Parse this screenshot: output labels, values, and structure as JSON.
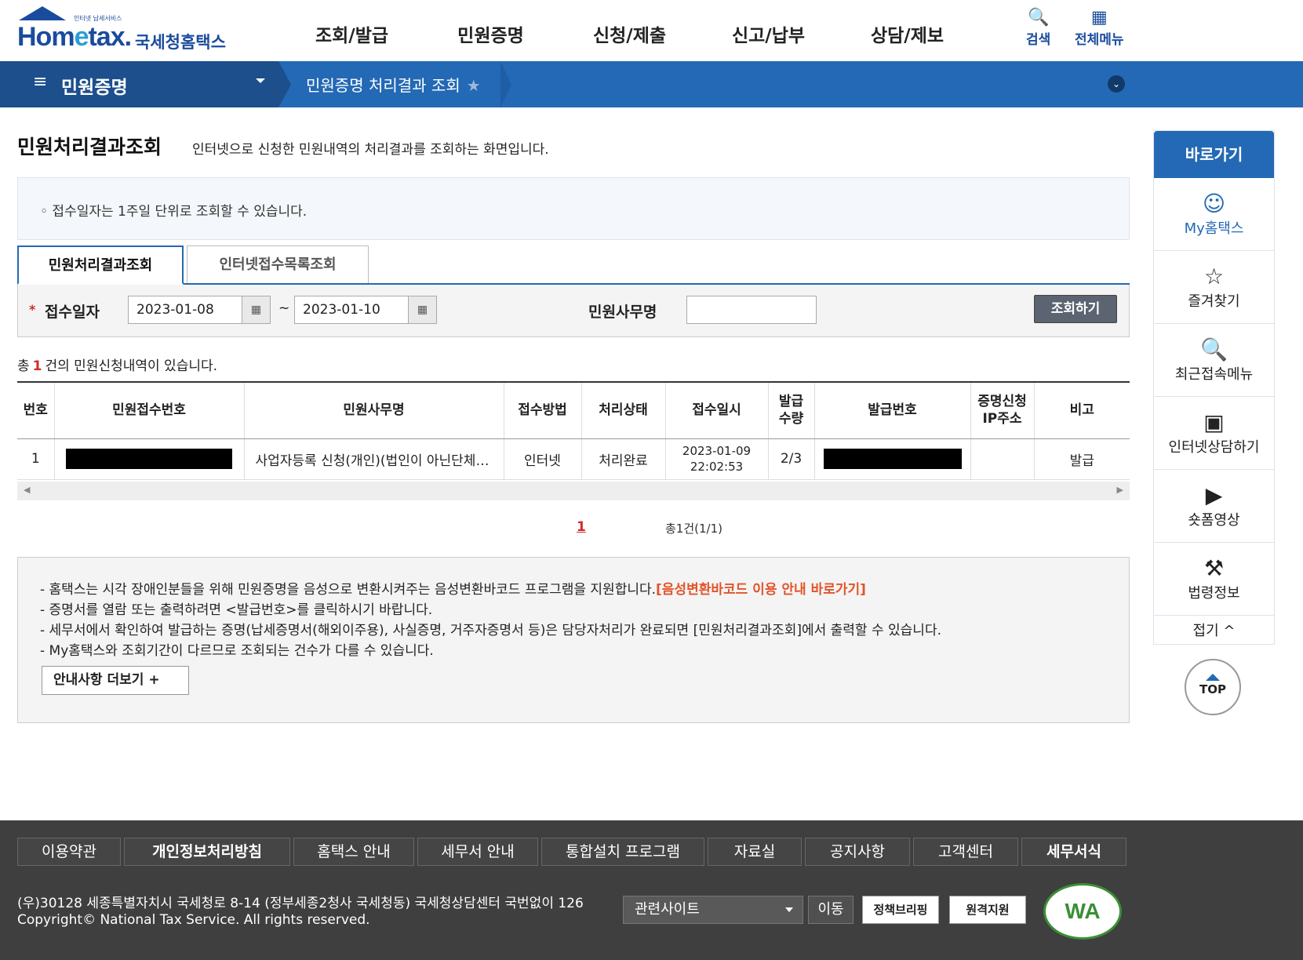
{
  "header": {
    "logo_tiny": "인터넷 납세서비스",
    "logo_main_a": "Hom",
    "logo_main_e": "e",
    "logo_main_b": "tax.",
    "logo_sub": "국세청홈택스",
    "gnb": [
      "조회/발급",
      "민원증명",
      "신청/제출",
      "신고/납부",
      "상담/제보"
    ],
    "search_label": "검색",
    "allmenu_label": "전체메뉴"
  },
  "navbar": {
    "menu_label": "민원증명",
    "breadcrumb": "민원증명 처리결과 조회"
  },
  "page": {
    "title": "민원처리결과조회",
    "description": "인터넷으로 신청한 민원내역의 처리결과를 조회하는 화면입니다.",
    "notice": "◦ 접수일자는 1주일 단위로 조회할 수 있습니다."
  },
  "tabs": [
    "민원처리결과조회",
    "인터넷접수목록조회"
  ],
  "search": {
    "required_mark": "*",
    "date_label": "접수일자",
    "date_from": "2023-01-08",
    "date_to": "2023-01-10",
    "tilde": "~",
    "office_label": "민원사무명",
    "office_value": "",
    "search_button": "조회하기"
  },
  "count": {
    "prefix": "총",
    "num": "1",
    "suffix": "건의 민원신청내역이 있습니다."
  },
  "table": {
    "headers": [
      "번호",
      "민원접수번호",
      "민원사무명",
      "접수방법",
      "처리상태",
      "접수일시",
      "발급\n수량",
      "발급번호",
      "증명신청\nIP주소",
      "비고"
    ],
    "rows": [
      {
        "no": "1",
        "office": "사업자등록 신청(개인)(법인이 아닌단체 포함)",
        "method": "인터넷",
        "status": "처리완료",
        "date": "2023-01-09",
        "time": "22:02:53",
        "qty": "2/3",
        "ip": "",
        "note": "발급"
      }
    ]
  },
  "pager": {
    "current": "1",
    "total": "총1건(1/1)"
  },
  "info": {
    "line1": "- 홈택스는 시각 장애인분들을 위해 민원증명을 음성으로 변환시켜주는 음성변환바코드 프로그램을 지원합니다.",
    "line1_link": "[음성변환바코드 이용 안내 바로가기]",
    "line2": "- 증명서를 열람 또는 출력하려면 <발급번호>를 클릭하시기 바랍니다.",
    "line3": "- 세무서에서 확인하여 발급하는 증명(납세증명서(해외이주용), 사실증명, 거주자증명서 등)은 담당자처리가 완료되면 [민원처리결과조회]에서 출력할 수 있습니다.",
    "line4": "- My홈택스와 조회기간이 다르므로 조회되는 건수가 다를 수 있습니다.",
    "more_button": "안내사항 더보기 +"
  },
  "quick": {
    "title": "바로가기",
    "items": [
      "My홈택스",
      "즐겨찾기",
      "최근접속메뉴",
      "인터넷상담하기",
      "숏폼영상",
      "법령정보"
    ],
    "fold": "접기 ^",
    "top": "TOP"
  },
  "footer": {
    "links": [
      "이용약관",
      "개인정보처리방침",
      "홈택스 안내",
      "세무서 안내",
      "통합설치 프로그램",
      "자료실",
      "공지사항",
      "고객센터",
      "세무서식"
    ],
    "address": "(우)30128 세종특별자치시 국세청로 8-14 (정부세종2청사 국세청동) 국세청상담센터 국번없이 126",
    "copyright": "Copyright© National Tax Service. All rights reserved.",
    "related_select": "관련사이트",
    "move_button": "이동",
    "policy_button": "정책브리핑",
    "remote_button": "원격지원",
    "wa_mark": "WA"
  }
}
